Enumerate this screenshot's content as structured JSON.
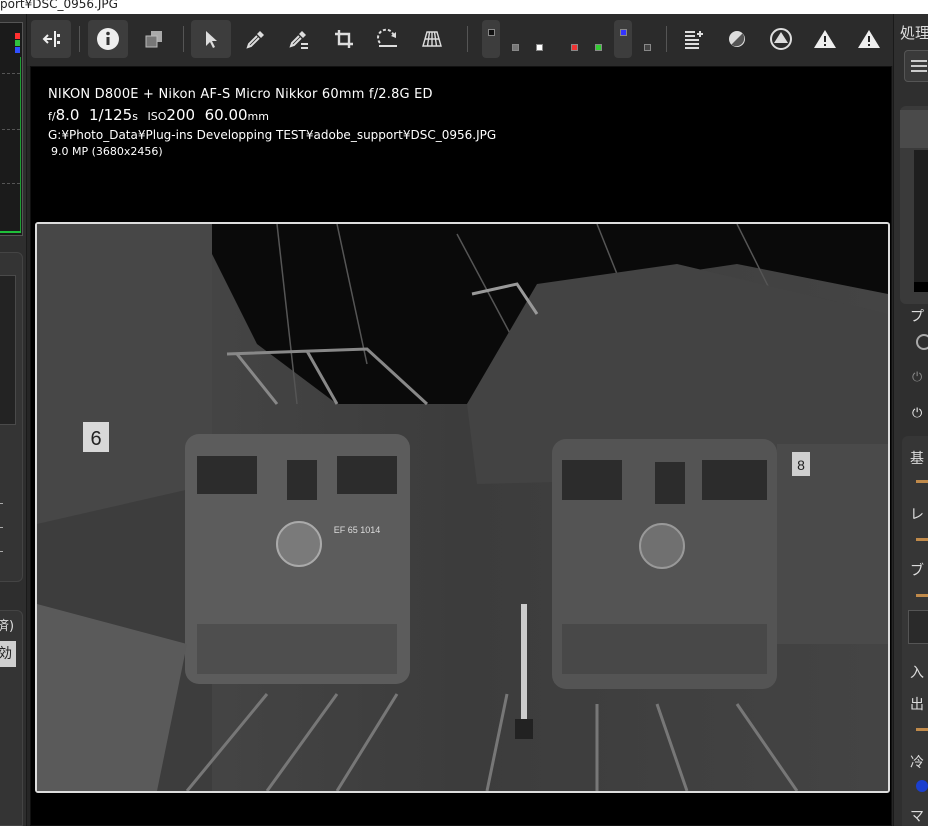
{
  "window": {
    "title_fragment": "port¥DSC_0956.JPG"
  },
  "left_panel": {
    "text_1": "済)",
    "text_2": "効"
  },
  "toolbar": {
    "icons": [
      "compare-split-icon",
      "info-icon",
      "overlay-icon",
      "select-arrow-icon",
      "eyedropper-icon",
      "gray-eyedropper-icon",
      "crop-icon",
      "rotate-icon",
      "perspective-grid-icon",
      "channel-black-icon",
      "channel-gray-icon",
      "channel-white-icon",
      "channel-red-icon",
      "channel-green-icon",
      "channel-blue-icon",
      "channel-lum-icon",
      "adjust-list-icon",
      "contrast-icon",
      "highlight-warning-icon",
      "clip-warning-icon",
      "clip-warning-2-icon"
    ]
  },
  "viewer": {
    "camera_lens": "NIKON D800E + Nikon AF-S Micro Nikkor 60mm f/2.8G ED",
    "aperture_prefix": "f/",
    "aperture": "8.0",
    "shutter": "1/125",
    "shutter_unit": "s",
    "iso_prefix": "ISO",
    "iso": "200",
    "focal": "60.00",
    "focal_unit": "mm",
    "file_path": "G:¥Photo_Data¥Plug-ins Developping TEST¥adobe_support¥DSC_0956.JPG",
    "resolution": "9.0 MP (3680x2456)",
    "photo_sign_6": "6",
    "photo_sign_8": "8",
    "photo_loco_number": "EF 65 1014"
  },
  "right_panel": {
    "title": "処理",
    "label_1": "プ",
    "label_2": "基",
    "label_3": "レ",
    "label_4": "ブ",
    "label_5": "入",
    "label_6": "出",
    "label_7": "冷",
    "label_8": "マ"
  },
  "colors": {
    "accent_slider": "#c08a4a",
    "blue_dot": "#1b3fcf",
    "histogram_trace": "#1fbf3a"
  }
}
